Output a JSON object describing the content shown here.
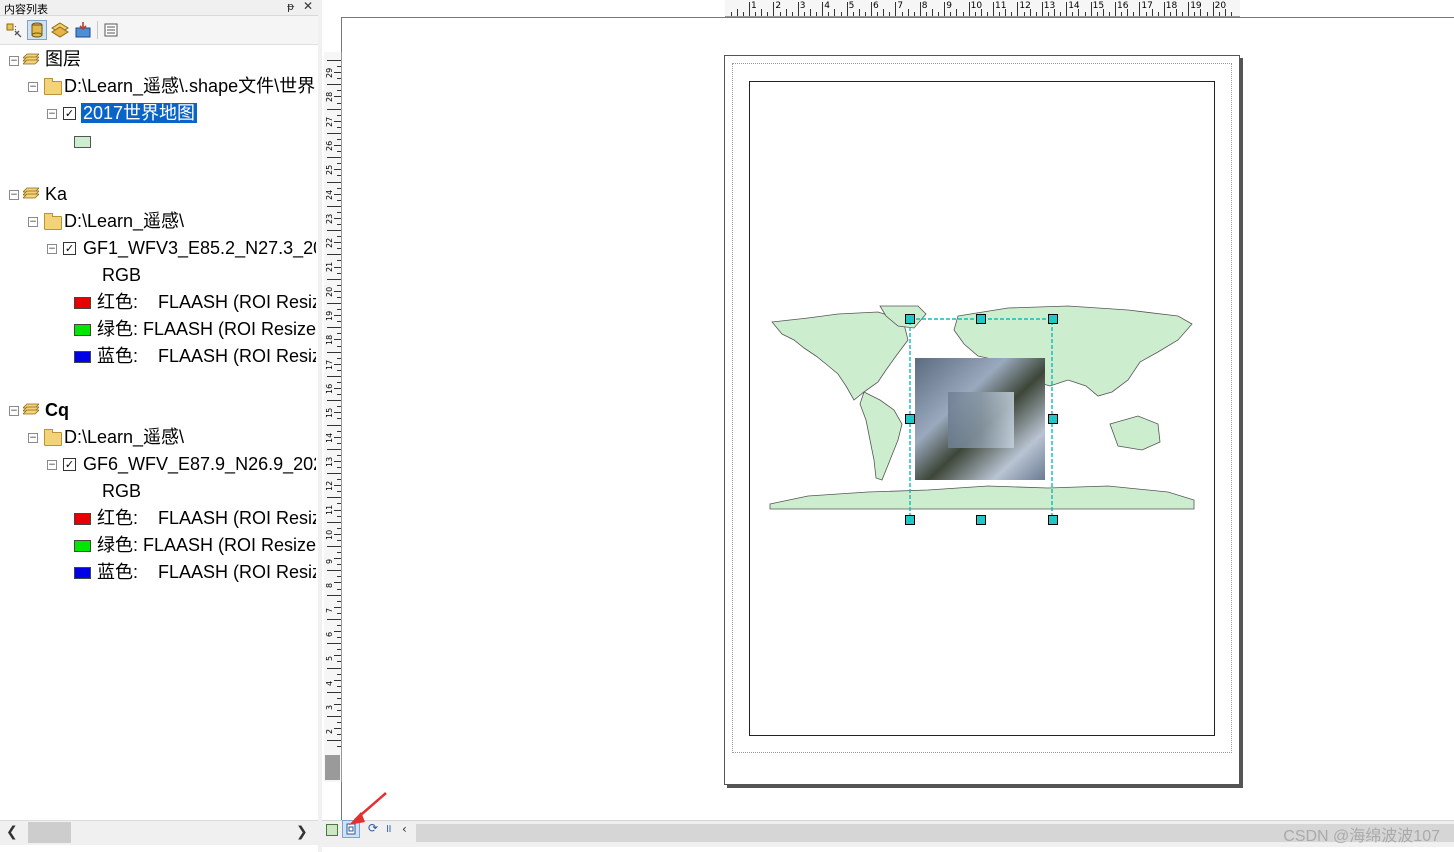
{
  "toc": {
    "title": "内容列表",
    "pin_glyph": "ᵽ",
    "close_glyph": "✕",
    "groups": [
      {
        "name": "图层",
        "path": "D:\\Learn_遥感\\.shape文件\\世界",
        "layer": "2017世界地图",
        "layer_checked": true,
        "swatch_color": "#cdeece"
      },
      {
        "name": "Ka",
        "path": "D:\\Learn_遥感\\",
        "layer": "GF1_WFV3_E85.2_N27.3_20",
        "layer_checked": true,
        "rgb_label": "RGB",
        "bands": [
          {
            "label": "红色:    FLAASH (ROI Resiz",
            "color": "#e60000"
          },
          {
            "label": "绿色: FLAASH (ROI Resize",
            "color": "#00e600"
          },
          {
            "label": "蓝色:    FLAASH (ROI Resiz",
            "color": "#0000e6"
          }
        ]
      },
      {
        "name": "Cq",
        "path": "D:\\Learn_遥感\\",
        "layer": "GF6_WFV_E87.9_N26.9_202",
        "layer_checked": true,
        "rgb_label": "RGB",
        "bands": [
          {
            "label": "红色:    FLAASH (ROI Resiz",
            "color": "#e60000"
          },
          {
            "label": "绿色: FLAASH (ROI Resize",
            "color": "#00e600"
          },
          {
            "label": "蓝色:    FLAASH (ROI Resiz",
            "color": "#0000e6"
          }
        ]
      }
    ]
  },
  "ruler": {
    "h_labels": [
      "1",
      "2",
      "3",
      "4",
      "5",
      "6",
      "7",
      "8",
      "9",
      "10",
      "11",
      "12",
      "13",
      "14",
      "15",
      "16",
      "17",
      "18",
      "19",
      "20"
    ],
    "v_labels": [
      "29",
      "28",
      "27",
      "26",
      "25",
      "24",
      "23",
      "22",
      "21",
      "20",
      "19",
      "18",
      "17",
      "16",
      "15",
      "14",
      "13",
      "12",
      "11",
      "10",
      "9",
      "8",
      "7",
      "6",
      "5",
      "4",
      "3",
      "2",
      "1"
    ]
  },
  "watermark": "CSDN @海绵波波107",
  "colors": {
    "selection": "#0a64c8",
    "land": "#cdeece",
    "frame_handles": "#17b8b8"
  }
}
